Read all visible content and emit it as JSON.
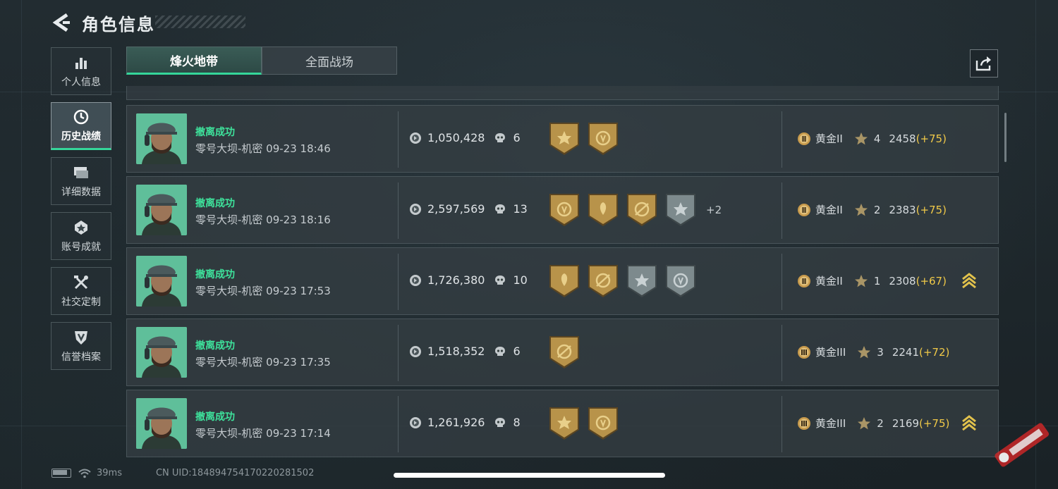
{
  "header": {
    "title": "角色信息"
  },
  "sidebar": {
    "items": [
      {
        "label": "个人信息",
        "icon": "bar-chart-icon",
        "active": false
      },
      {
        "label": "历史战绩",
        "icon": "clock-icon",
        "active": true
      },
      {
        "label": "详细数据",
        "icon": "cards-icon",
        "active": false
      },
      {
        "label": "账号成就",
        "icon": "badge-icon",
        "active": false
      },
      {
        "label": "社交定制",
        "icon": "tools-icon",
        "active": false
      },
      {
        "label": "信誉档案",
        "icon": "shield-icon",
        "active": false
      }
    ]
  },
  "tabs": [
    {
      "label": "烽火地带",
      "active": true
    },
    {
      "label": "全面战场",
      "active": false
    }
  ],
  "share": {
    "icon": "share-icon"
  },
  "records": [
    {
      "status": "撤离成功",
      "map": "零号大坝-机密 09-23 18:46",
      "value": "1,050,428",
      "kills": "6",
      "medals": [
        "gold",
        "gold"
      ],
      "more": "",
      "rank": "黄金II",
      "rank_tier": "II",
      "stars": "4",
      "points": "2458",
      "delta": "(+75)",
      "promo": false
    },
    {
      "status": "撤离成功",
      "map": "零号大坝-机密 09-23 18:16",
      "value": "2,597,569",
      "kills": "13",
      "medals": [
        "gold",
        "gold",
        "gold",
        "silver"
      ],
      "more": "+2",
      "rank": "黄金II",
      "rank_tier": "II",
      "stars": "2",
      "points": "2383",
      "delta": "(+75)",
      "promo": false
    },
    {
      "status": "撤离成功",
      "map": "零号大坝-机密 09-23 17:53",
      "value": "1,726,380",
      "kills": "10",
      "medals": [
        "gold",
        "gold",
        "silver",
        "silver"
      ],
      "more": "",
      "rank": "黄金II",
      "rank_tier": "II",
      "stars": "1",
      "points": "2308",
      "delta": "(+67)",
      "promo": true
    },
    {
      "status": "撤离成功",
      "map": "零号大坝-机密 09-23 17:35",
      "value": "1,518,352",
      "kills": "6",
      "medals": [
        "gold"
      ],
      "more": "",
      "rank": "黄金III",
      "rank_tier": "III",
      "stars": "3",
      "points": "2241",
      "delta": "(+72)",
      "promo": false
    },
    {
      "status": "撤离成功",
      "map": "零号大坝-机密 09-23 17:14",
      "value": "1,261,926",
      "kills": "8",
      "medals": [
        "gold",
        "gold"
      ],
      "more": "",
      "rank": "黄金III",
      "rank_tier": "III",
      "stars": "2",
      "points": "2169",
      "delta": "(+75)",
      "promo": true
    }
  ],
  "footer": {
    "ping": "39ms",
    "uid": "CN UID:184894754170220281502"
  },
  "colors": {
    "accent": "#35d69a",
    "success_text": "#3ee39c",
    "delta": "#f0c948",
    "gold_medal": "#b8934a",
    "silver_medal": "#7d8a8d"
  }
}
